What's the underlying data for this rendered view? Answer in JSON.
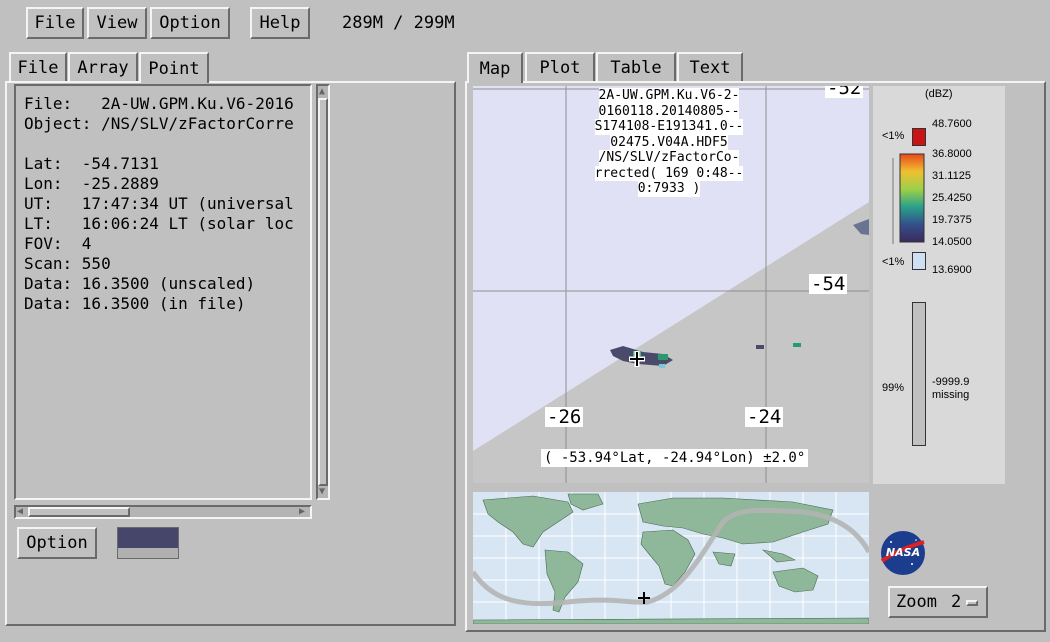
{
  "menubar": {
    "file": "File",
    "view": "View",
    "option": "Option",
    "help": "Help",
    "memory": "289M / 299M"
  },
  "left_tabs": [
    "File",
    "Array",
    "Point"
  ],
  "info": {
    "lines": [
      "File:   2A-UW.GPM.Ku.V6-2016",
      "Object: /NS/SLV/zFactorCorre",
      "",
      "Lat:  -54.7131",
      "Lon:  -25.2889",
      "UT:   17:47:34 UT (universal",
      "LT:   16:06:24 LT (solar loc",
      "FOV:  4",
      "Scan: 550",
      "Data: 16.3500 (unscaled)",
      "Data: 16.3500 (in file)"
    ]
  },
  "left_option_button": "Option",
  "swatch_color": "#46466a",
  "right_tabs": [
    "Map",
    "Plot",
    "Table",
    "Text"
  ],
  "map": {
    "title_lines": [
      "2A-UW.GPM.Ku.V6-2-",
      "0160118.20140805--",
      "S174108-E191341.0--",
      "02475.V04A.HDF5",
      "/NS/SLV/zFactorCo-",
      "rrected( 169 0:48--",
      "0:7933 )"
    ],
    "lat_label_top": "-52",
    "lat_label_mid": "-54",
    "lon_label_left": "-26",
    "lon_label_right": "-24",
    "cursor_readout": "( -53.94°Lat, -24.94°Lon) ±2.0°"
  },
  "legend": {
    "unit": "(dBZ)",
    "over_pct": "<1%",
    "over_value": "48.7600",
    "ticks": [
      "36.8000",
      "31.1125",
      "25.4250",
      "19.7375",
      "14.0500"
    ],
    "under_pct": "<1%",
    "under_value": "13.6900",
    "missing_pct": "99%",
    "missing_value": "-9999.9",
    "missing_label": "missing",
    "over_color": "#c81414",
    "under_color": "#d0e0f4",
    "missing_color": "#c0c0c0"
  },
  "zoom": {
    "label": "Zoom",
    "value": "2"
  },
  "logo_text": "NASA"
}
